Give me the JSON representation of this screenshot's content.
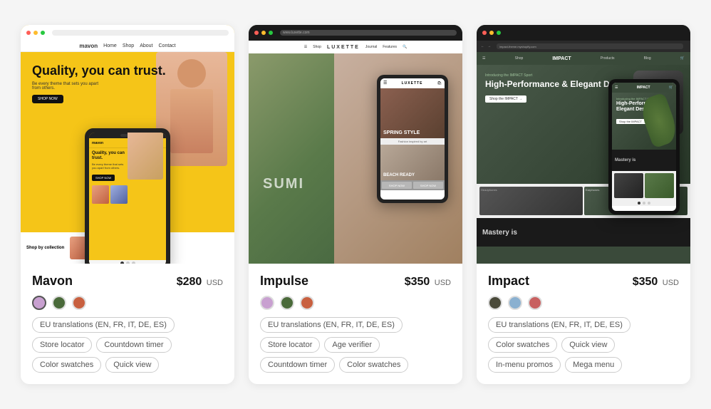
{
  "products": [
    {
      "id": "mavon",
      "name": "Mavon",
      "price": "$280",
      "currency": "USD",
      "swatches": [
        {
          "color": "#c8a0d0",
          "selected": true
        },
        {
          "color": "#4a6a3a",
          "selected": false
        },
        {
          "color": "#c86040",
          "selected": false
        }
      ],
      "tags": [
        "EU translations (EN, FR, IT, DE, ES)",
        "Store locator",
        "Countdown timer",
        "Color swatches",
        "Quick view"
      ],
      "screenshot_theme": "mavon"
    },
    {
      "id": "impulse",
      "name": "Impulse",
      "price": "$350",
      "currency": "USD",
      "swatches": [
        {
          "color": "#c8a0d0",
          "selected": false
        },
        {
          "color": "#4a6a3a",
          "selected": false
        },
        {
          "color": "#c86040",
          "selected": false
        }
      ],
      "tags": [
        "EU translations (EN, FR, IT, DE, ES)",
        "Store locator",
        "Age verifier",
        "Countdown timer",
        "Color swatches"
      ],
      "screenshot_theme": "impulse"
    },
    {
      "id": "impact",
      "name": "Impact",
      "price": "$350",
      "currency": "USD",
      "swatches": [
        {
          "color": "#4a4a3a",
          "selected": false
        },
        {
          "color": "#8ab0d0",
          "selected": false
        },
        {
          "color": "#c86060",
          "selected": false
        }
      ],
      "tags": [
        "EU translations (EN, FR, IT, DE, ES)",
        "Color swatches",
        "Quick view",
        "In-menu promos",
        "Mega menu"
      ],
      "screenshot_theme": "impact"
    }
  ],
  "labels": {
    "usd": "USD",
    "mavon_hero_h1": "Quality, you can trust.",
    "mavon_hero_p": "Be every theme that sets you apart from others.",
    "mavon_shop_btn": "SHOP NOW",
    "mavon_collection": "Shop by collection",
    "mavon_logo": "mavon",
    "impulse_logo": "LUXETTE",
    "impulse_summer": "SUMI",
    "impulse_spring": "SPRING STYLE",
    "impulse_beach": "BEACH READY",
    "impact_logo": "IMPACT",
    "impact_headline": "High-Performance & Elegant Design",
    "impact_mastery": "Mastery is",
    "impact_shop": "Shop the IMPACT →"
  }
}
